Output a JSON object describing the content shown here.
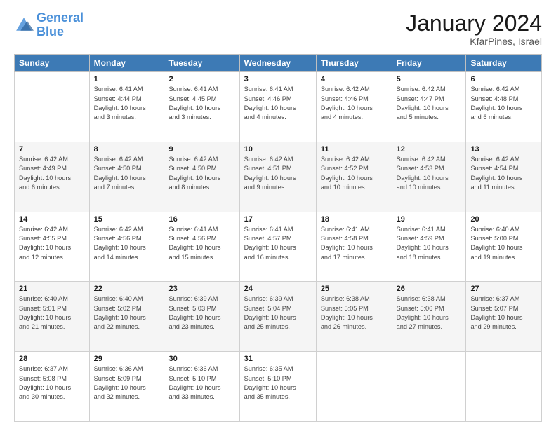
{
  "logo": {
    "name_part1": "General",
    "name_part2": "Blue"
  },
  "header": {
    "month_year": "January 2024",
    "location": "KfarPines, Israel"
  },
  "columns": [
    "Sunday",
    "Monday",
    "Tuesday",
    "Wednesday",
    "Thursday",
    "Friday",
    "Saturday"
  ],
  "weeks": [
    [
      {
        "day": "",
        "info": ""
      },
      {
        "day": "1",
        "info": "Sunrise: 6:41 AM\nSunset: 4:44 PM\nDaylight: 10 hours\nand 3 minutes."
      },
      {
        "day": "2",
        "info": "Sunrise: 6:41 AM\nSunset: 4:45 PM\nDaylight: 10 hours\nand 3 minutes."
      },
      {
        "day": "3",
        "info": "Sunrise: 6:41 AM\nSunset: 4:46 PM\nDaylight: 10 hours\nand 4 minutes."
      },
      {
        "day": "4",
        "info": "Sunrise: 6:42 AM\nSunset: 4:46 PM\nDaylight: 10 hours\nand 4 minutes."
      },
      {
        "day": "5",
        "info": "Sunrise: 6:42 AM\nSunset: 4:47 PM\nDaylight: 10 hours\nand 5 minutes."
      },
      {
        "day": "6",
        "info": "Sunrise: 6:42 AM\nSunset: 4:48 PM\nDaylight: 10 hours\nand 6 minutes."
      }
    ],
    [
      {
        "day": "7",
        "info": "Sunrise: 6:42 AM\nSunset: 4:49 PM\nDaylight: 10 hours\nand 6 minutes."
      },
      {
        "day": "8",
        "info": "Sunrise: 6:42 AM\nSunset: 4:50 PM\nDaylight: 10 hours\nand 7 minutes."
      },
      {
        "day": "9",
        "info": "Sunrise: 6:42 AM\nSunset: 4:50 PM\nDaylight: 10 hours\nand 8 minutes."
      },
      {
        "day": "10",
        "info": "Sunrise: 6:42 AM\nSunset: 4:51 PM\nDaylight: 10 hours\nand 9 minutes."
      },
      {
        "day": "11",
        "info": "Sunrise: 6:42 AM\nSunset: 4:52 PM\nDaylight: 10 hours\nand 10 minutes."
      },
      {
        "day": "12",
        "info": "Sunrise: 6:42 AM\nSunset: 4:53 PM\nDaylight: 10 hours\nand 10 minutes."
      },
      {
        "day": "13",
        "info": "Sunrise: 6:42 AM\nSunset: 4:54 PM\nDaylight: 10 hours\nand 11 minutes."
      }
    ],
    [
      {
        "day": "14",
        "info": "Sunrise: 6:42 AM\nSunset: 4:55 PM\nDaylight: 10 hours\nand 12 minutes."
      },
      {
        "day": "15",
        "info": "Sunrise: 6:42 AM\nSunset: 4:56 PM\nDaylight: 10 hours\nand 14 minutes."
      },
      {
        "day": "16",
        "info": "Sunrise: 6:41 AM\nSunset: 4:56 PM\nDaylight: 10 hours\nand 15 minutes."
      },
      {
        "day": "17",
        "info": "Sunrise: 6:41 AM\nSunset: 4:57 PM\nDaylight: 10 hours\nand 16 minutes."
      },
      {
        "day": "18",
        "info": "Sunrise: 6:41 AM\nSunset: 4:58 PM\nDaylight: 10 hours\nand 17 minutes."
      },
      {
        "day": "19",
        "info": "Sunrise: 6:41 AM\nSunset: 4:59 PM\nDaylight: 10 hours\nand 18 minutes."
      },
      {
        "day": "20",
        "info": "Sunrise: 6:40 AM\nSunset: 5:00 PM\nDaylight: 10 hours\nand 19 minutes."
      }
    ],
    [
      {
        "day": "21",
        "info": "Sunrise: 6:40 AM\nSunset: 5:01 PM\nDaylight: 10 hours\nand 21 minutes."
      },
      {
        "day": "22",
        "info": "Sunrise: 6:40 AM\nSunset: 5:02 PM\nDaylight: 10 hours\nand 22 minutes."
      },
      {
        "day": "23",
        "info": "Sunrise: 6:39 AM\nSunset: 5:03 PM\nDaylight: 10 hours\nand 23 minutes."
      },
      {
        "day": "24",
        "info": "Sunrise: 6:39 AM\nSunset: 5:04 PM\nDaylight: 10 hours\nand 25 minutes."
      },
      {
        "day": "25",
        "info": "Sunrise: 6:38 AM\nSunset: 5:05 PM\nDaylight: 10 hours\nand 26 minutes."
      },
      {
        "day": "26",
        "info": "Sunrise: 6:38 AM\nSunset: 5:06 PM\nDaylight: 10 hours\nand 27 minutes."
      },
      {
        "day": "27",
        "info": "Sunrise: 6:37 AM\nSunset: 5:07 PM\nDaylight: 10 hours\nand 29 minutes."
      }
    ],
    [
      {
        "day": "28",
        "info": "Sunrise: 6:37 AM\nSunset: 5:08 PM\nDaylight: 10 hours\nand 30 minutes."
      },
      {
        "day": "29",
        "info": "Sunrise: 6:36 AM\nSunset: 5:09 PM\nDaylight: 10 hours\nand 32 minutes."
      },
      {
        "day": "30",
        "info": "Sunrise: 6:36 AM\nSunset: 5:10 PM\nDaylight: 10 hours\nand 33 minutes."
      },
      {
        "day": "31",
        "info": "Sunrise: 6:35 AM\nSunset: 5:10 PM\nDaylight: 10 hours\nand 35 minutes."
      },
      {
        "day": "",
        "info": ""
      },
      {
        "day": "",
        "info": ""
      },
      {
        "day": "",
        "info": ""
      }
    ]
  ]
}
